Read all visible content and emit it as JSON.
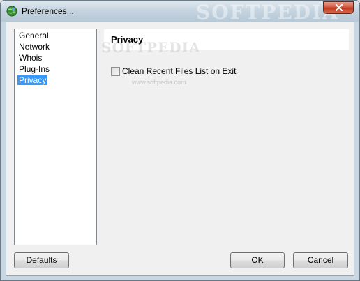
{
  "window": {
    "title": "Preferences...",
    "watermark": "SOFTPEDIA",
    "close_icon": "close-icon"
  },
  "nav": {
    "items": [
      {
        "label": "General",
        "selected": false
      },
      {
        "label": "Network",
        "selected": false
      },
      {
        "label": "Whois",
        "selected": false
      },
      {
        "label": "Plug-Ins",
        "selected": false
      },
      {
        "label": "Privacy",
        "selected": true
      }
    ]
  },
  "panel": {
    "title": "Privacy",
    "watermark": "SOFTPEDIA",
    "watermark_url": "www.softpedia.com",
    "options": [
      {
        "label": "Clean Recent Files List on Exit",
        "checked": false
      }
    ]
  },
  "buttons": {
    "defaults": "Defaults",
    "ok": "OK",
    "cancel": "Cancel"
  },
  "colors": {
    "selection": "#3399ff",
    "close_button": "#c23a22"
  }
}
